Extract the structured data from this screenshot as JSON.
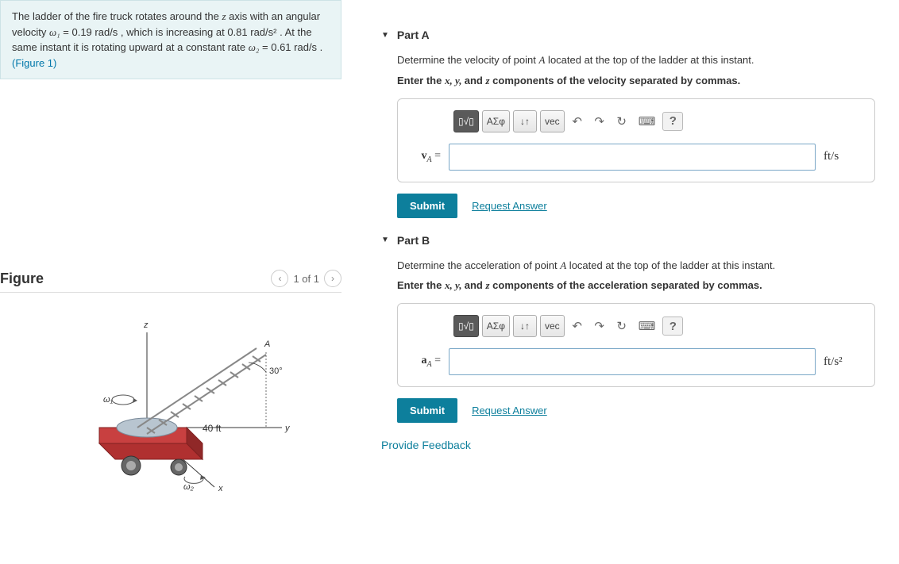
{
  "problem": {
    "text_prefix": "The ladder of the fire truck rotates around the ",
    "axis_var": "z",
    "text_mid1": " axis with an angular velocity ",
    "w1_var": "ω₁",
    "w1_val": " = 0.19 rad/s",
    "text_mid2": " , which is increasing at ",
    "alpha_val": "0.81 rad/s²",
    "text_mid3": " . At the same instant it is rotating upward at a constant rate ",
    "w2_var": "ω₂",
    "w2_val": " = 0.61 rad/s",
    "text_end": " .",
    "figure_link": "(Figure 1)"
  },
  "figure": {
    "title": "Figure",
    "counter": "1 of 1",
    "length_label": "40 ft",
    "angle_label": "30°"
  },
  "partA": {
    "title": "Part A",
    "prompt_pre": "Determine the velocity of point ",
    "point_var": "A",
    "prompt_post": " located at the top of the ladder at this instant.",
    "instr_pre": "Enter the ",
    "instr_vars": "x, y, ",
    "instr_and": "and ",
    "instr_z": "z",
    "instr_post": " components of the velocity separated by commas.",
    "var_label_html": "v",
    "var_sub": "A",
    "unit": "ft/s",
    "submit": "Submit",
    "request": "Request Answer"
  },
  "partB": {
    "title": "Part B",
    "prompt_pre": "Determine the acceleration of point ",
    "point_var": "A",
    "prompt_post": " located at the top of the ladder at this instant.",
    "instr_pre": "Enter the ",
    "instr_vars": "x, y, ",
    "instr_and": "and ",
    "instr_z": "z",
    "instr_post": " components of the acceleration separated by commas.",
    "var_label_html": "a",
    "var_sub": "A",
    "unit": "ft/s²",
    "submit": "Submit",
    "request": "Request Answer"
  },
  "toolbar": {
    "template": "▯√▯",
    "greek": "ΑΣφ",
    "updown": "↓↑",
    "vec": "vec",
    "undo": "↶",
    "redo": "↷",
    "reset": "↻",
    "keyboard": "⌨",
    "help": "?"
  },
  "feedback": "Provide Feedback"
}
